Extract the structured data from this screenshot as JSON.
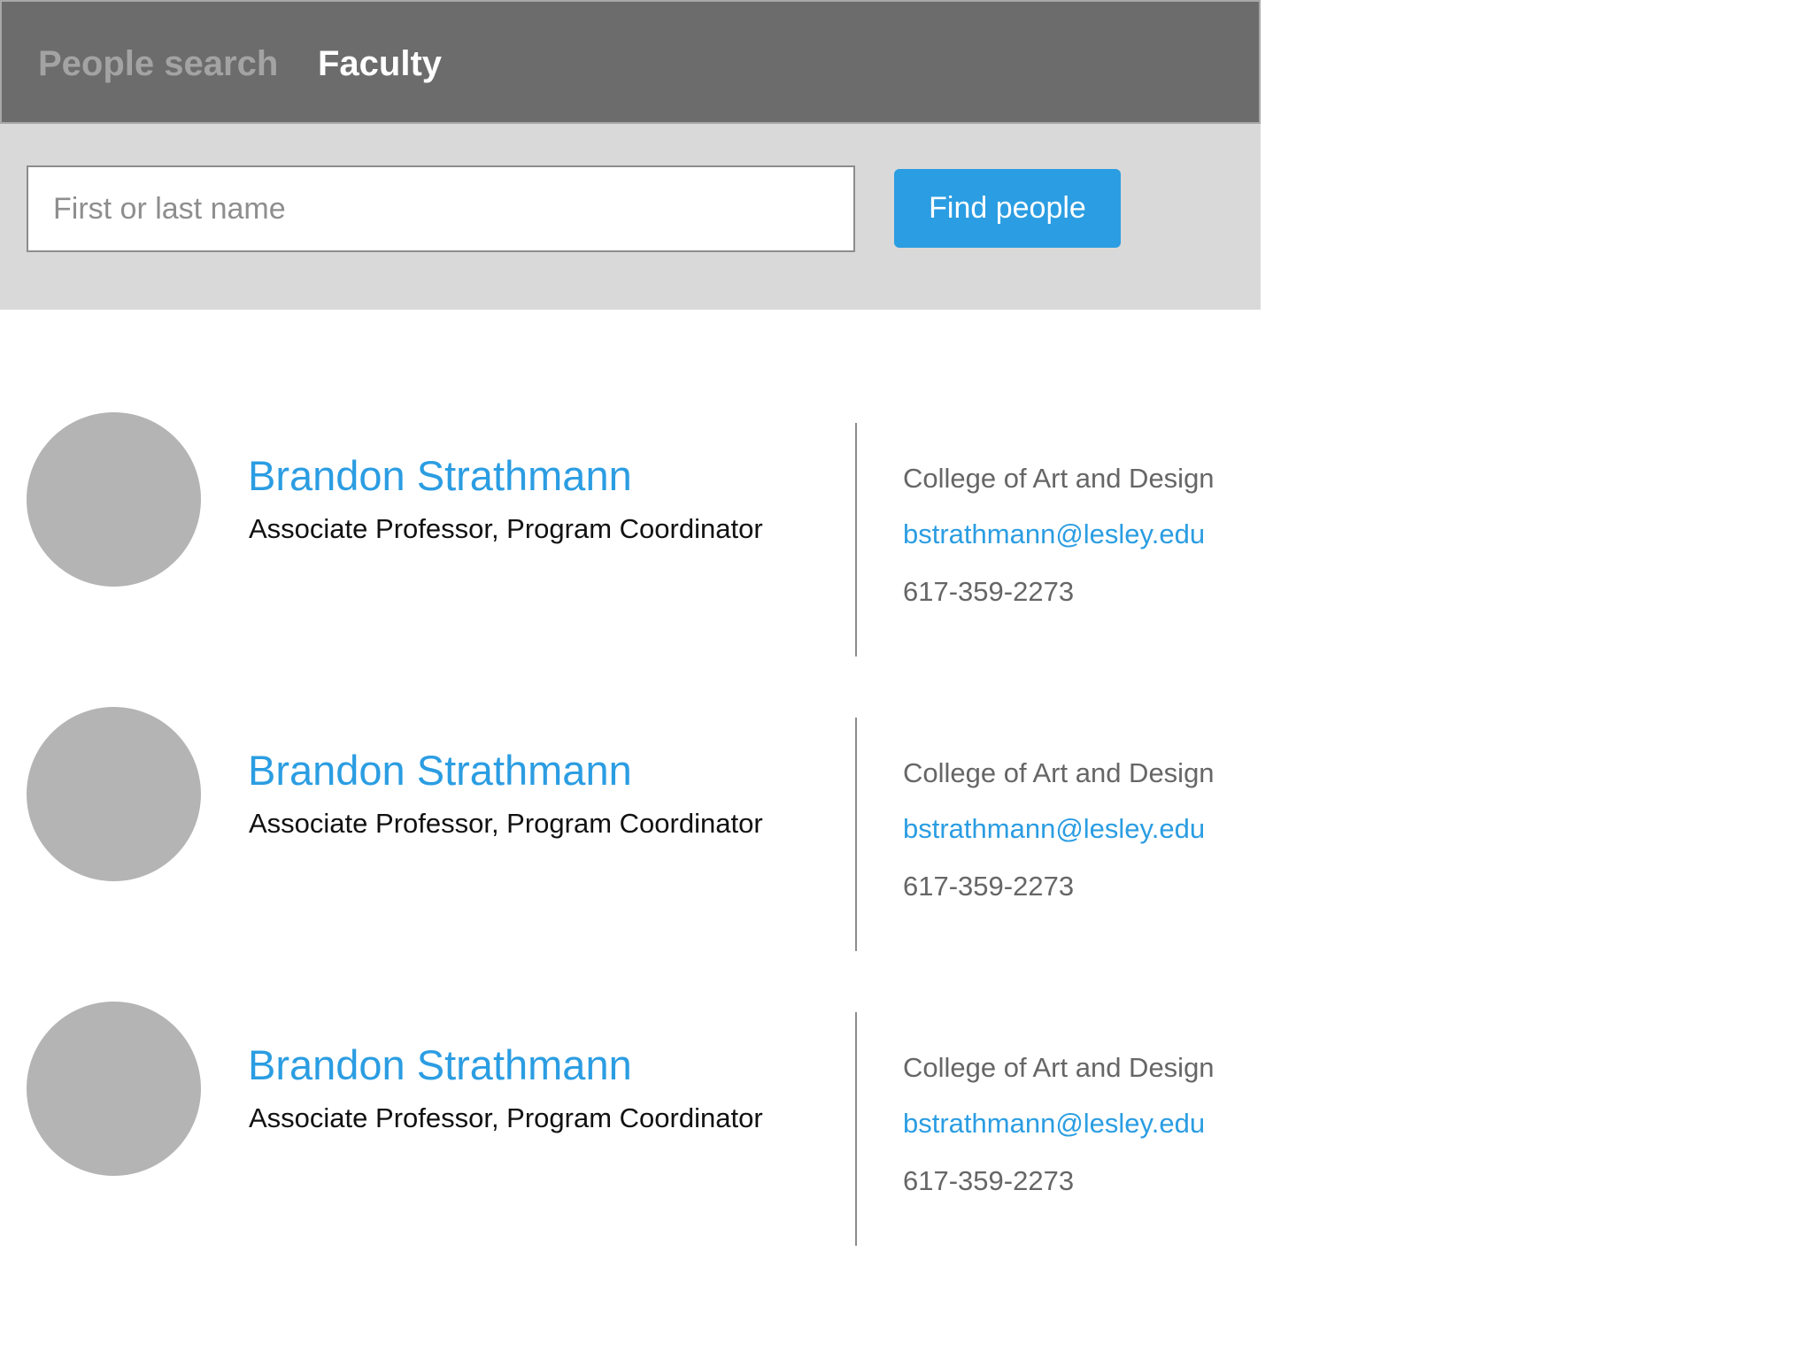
{
  "header": {
    "breadcrumb_parent": "People search",
    "breadcrumb_current": "Faculty"
  },
  "search": {
    "placeholder": "First or last name",
    "value": "",
    "button_label": "Find people"
  },
  "results": [
    {
      "name": "Brandon Strathmann",
      "title": "Associate Professor, Program Coordinator",
      "department": "College of Art and Design",
      "email": "bstrathmann@lesley.edu",
      "phone": "617-359-2273"
    },
    {
      "name": "Brandon Strathmann",
      "title": "Associate Professor, Program Coordinator",
      "department": "College of Art and Design",
      "email": "bstrathmann@lesley.edu",
      "phone": "617-359-2273"
    },
    {
      "name": "Brandon Strathmann",
      "title": "Associate Professor, Program Coordinator",
      "department": "College of Art and Design",
      "email": "bstrathmann@lesley.edu",
      "phone": "617-359-2273"
    }
  ],
  "colors": {
    "header_bg": "#6c6c6c",
    "search_bg": "#d9d9d9",
    "accent": "#2b9de2",
    "avatar": "#b4b4b4"
  }
}
